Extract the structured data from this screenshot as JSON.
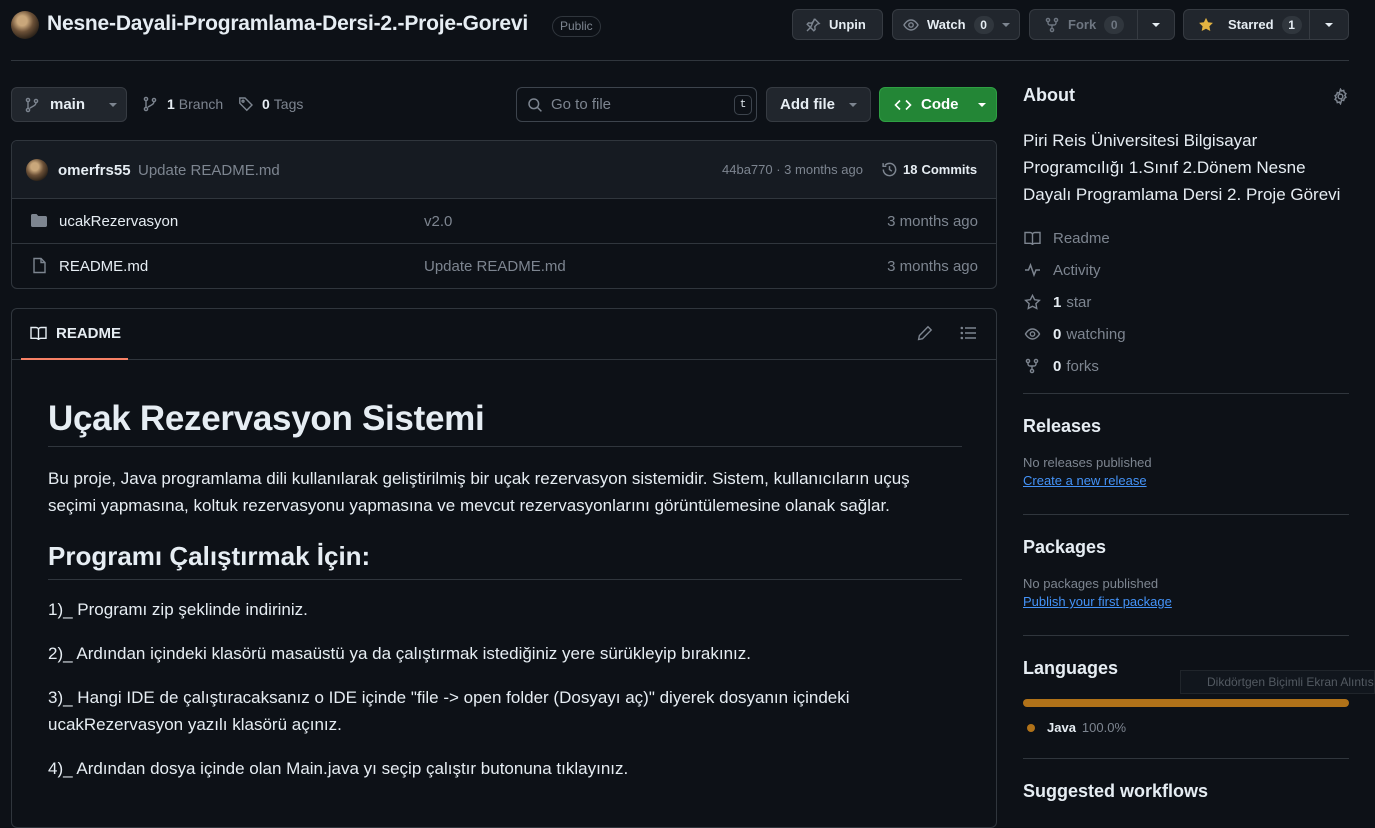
{
  "repo": {
    "name": "Nesne-Dayali-Programlama-Dersi-2.-Proje-Gorevi",
    "visibility": "Public"
  },
  "actions": {
    "unpin": "Unpin",
    "watch": "Watch",
    "watch_count": "0",
    "fork": "Fork",
    "fork_count": "0",
    "starred": "Starred",
    "star_count": "1"
  },
  "toolbar": {
    "branch": "main",
    "branches_count": "1",
    "branches_label": "Branch",
    "tags_count": "0",
    "tags_label": "Tags",
    "search_placeholder": "Go to file",
    "search_shortcut": "t",
    "add_file": "Add file",
    "code": "Code"
  },
  "latest_commit": {
    "author": "omerfrs55",
    "message": "Update README.md",
    "hash_time": "44ba770 · 3 months ago",
    "commits_count": "18",
    "commits_label": "Commits"
  },
  "files": [
    {
      "name": "ucakRezervasyon",
      "type": "folder",
      "message": "v2.0",
      "time": "3 months ago"
    },
    {
      "name": "README.md",
      "type": "file",
      "message": "Update README.md",
      "time": "3 months ago"
    }
  ],
  "readme": {
    "tab": "README",
    "title": "Uçak Rezervasyon Sistemi",
    "intro": "Bu proje, Java programlama dili kullanılarak geliştirilmiş bir uçak rezervasyon sistemidir. Sistem, kullanıcıların uçuş seçimi yapmasına, koltuk rezervasyonu yapmasına ve mevcut rezervasyonlarını görüntülemesine olanak sağlar.",
    "heading2": "Programı Çalıştırmak İçin:",
    "steps": [
      "1)_ Programı zip şeklinde indiriniz.",
      "2)_ Ardından içindeki klasörü masaüstü ya da çalıştırmak istediğiniz yere sürükleyip bırakınız.",
      "3)_ Hangi IDE de çalıştıracaksanız o IDE içinde \"file -> open folder (Dosyayı aç)\" diyerek dosyanın içindeki ucakRezervasyon yazılı klasörü açınız.",
      "4)_ Ardından dosya içinde olan Main.java yı seçip çalıştır butonuna tıklayınız."
    ]
  },
  "about": {
    "title": "About",
    "description": "Piri Reis Üniversitesi Bilgisayar Programcılığı 1.Sınıf 2.Dönem Nesne Dayalı Programlama Dersi 2. Proje Görevi",
    "readme": "Readme",
    "activity": "Activity",
    "stars_count": "1",
    "stars_label": "star",
    "watching_count": "0",
    "watching_label": "watching",
    "forks_count": "0",
    "forks_label": "forks"
  },
  "releases": {
    "title": "Releases",
    "empty": "No releases published",
    "link": "Create a new release"
  },
  "packages": {
    "title": "Packages",
    "empty": "No packages published",
    "link": "Publish your first package"
  },
  "languages": {
    "title": "Languages",
    "items": [
      {
        "name": "Java",
        "percent": "100.0%",
        "color": "#b07219"
      }
    ]
  },
  "suggested_workflows": {
    "title": "Suggested workflows"
  },
  "overlay_tooltip": "Dikdörtgen Biçimli Ekran Alıntısı",
  "colors": {
    "background": "#0d1117",
    "border": "#30363d",
    "primary_button": "#238636",
    "link": "#4493f8",
    "star": "#e3b341",
    "tab_underline": "#f78166"
  }
}
